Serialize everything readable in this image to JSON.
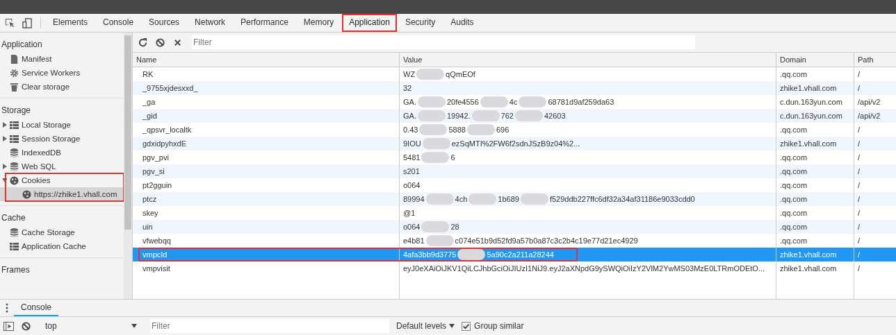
{
  "tabs": [
    {
      "label": "Elements",
      "selected": false,
      "highlighted": false
    },
    {
      "label": "Console",
      "selected": false,
      "highlighted": false
    },
    {
      "label": "Sources",
      "selected": false,
      "highlighted": false
    },
    {
      "label": "Network",
      "selected": false,
      "highlighted": false
    },
    {
      "label": "Performance",
      "selected": false,
      "highlighted": false
    },
    {
      "label": "Memory",
      "selected": false,
      "highlighted": false
    },
    {
      "label": "Application",
      "selected": true,
      "highlighted": true
    },
    {
      "label": "Security",
      "selected": false,
      "highlighted": false
    },
    {
      "label": "Audits",
      "selected": false,
      "highlighted": false
    }
  ],
  "sidebar": {
    "sections": [
      {
        "title": "Application",
        "items": [
          {
            "label": "Manifest",
            "kind": "file",
            "expandable": false,
            "selected": false,
            "highlighted": false
          },
          {
            "label": "Service Workers",
            "kind": "gear",
            "expandable": false,
            "selected": false,
            "highlighted": false
          },
          {
            "label": "Clear storage",
            "kind": "trash",
            "expandable": false,
            "selected": false,
            "highlighted": false
          }
        ]
      },
      {
        "title": "Storage",
        "items": [
          {
            "label": "Local Storage",
            "kind": "grid",
            "expandable": true,
            "selected": false,
            "highlighted": false
          },
          {
            "label": "Session Storage",
            "kind": "grid",
            "expandable": true,
            "selected": false,
            "highlighted": false
          },
          {
            "label": "IndexedDB",
            "kind": "db",
            "expandable": false,
            "selected": false,
            "highlighted": false
          },
          {
            "label": "Web SQL",
            "kind": "db",
            "expandable": true,
            "selected": false,
            "highlighted": false
          },
          {
            "label": "Cookies",
            "kind": "cookie",
            "expandable": true,
            "selected": false,
            "highlighted": true,
            "children": [
              {
                "label": "https://zhike1.vhall.com",
                "kind": "cookie",
                "expandable": false,
                "selected": true
              }
            ]
          }
        ]
      },
      {
        "title": "Cache",
        "items": [
          {
            "label": "Cache Storage",
            "kind": "db",
            "expandable": false,
            "selected": false,
            "highlighted": false
          },
          {
            "label": "Application Cache",
            "kind": "grid",
            "expandable": false,
            "selected": false,
            "highlighted": false
          }
        ]
      },
      {
        "title": "Frames"
      }
    ]
  },
  "filter": {
    "placeholder": "Filter"
  },
  "table": {
    "columns": [
      "Name",
      "Value",
      "Domain",
      "Path"
    ],
    "rows": [
      {
        "name": "RK",
        "value_parts": [
          "WZ",
          "qQmEOf"
        ],
        "domain": ".qq.com",
        "path": "/",
        "selected": false,
        "highlighted": false
      },
      {
        "name": "_9755xjdesxxd_",
        "value_parts": [
          "32"
        ],
        "domain": "zhike1.vhall.com",
        "path": "/",
        "selected": false,
        "highlighted": false
      },
      {
        "name": "_ga",
        "value_parts": [
          "GA.",
          "20fe4556",
          "4c",
          "68781d9af259da63"
        ],
        "domain": "c.dun.163yun.com",
        "path": "/api/v2",
        "selected": false,
        "highlighted": false
      },
      {
        "name": "_gid",
        "value_parts": [
          "GA.",
          "19942.",
          "762",
          "42603"
        ],
        "domain": "c.dun.163yun.com",
        "path": "/api/v2",
        "selected": false,
        "highlighted": false
      },
      {
        "name": "_qpsvr_localtk",
        "value_parts": [
          "0.43",
          "5888",
          "696"
        ],
        "domain": ".qq.com",
        "path": "/",
        "selected": false,
        "highlighted": false
      },
      {
        "name": "gdxidpyhxdE",
        "value_parts": [
          "9IOU",
          "ezSqMTI%2FW6f2sdnJSzB9z04%2..."
        ],
        "domain": "zhike1.vhall.com",
        "path": "/",
        "selected": false,
        "highlighted": false
      },
      {
        "name": "pgv_pvi",
        "value_parts": [
          "5481",
          "6"
        ],
        "domain": ".qq.com",
        "path": "/",
        "selected": false,
        "highlighted": false
      },
      {
        "name": "pgv_si",
        "value_parts": [
          "s201"
        ],
        "domain": ".qq.com",
        "path": "/",
        "selected": false,
        "highlighted": false
      },
      {
        "name": "pt2gguin",
        "value_parts": [
          "o064"
        ],
        "domain": ".qq.com",
        "path": "/",
        "selected": false,
        "highlighted": false
      },
      {
        "name": "ptcz",
        "value_parts": [
          "89994",
          "4ch",
          "1b689",
          "f529ddb227ffc6df32a34af31186e9033cdd0"
        ],
        "domain": ".qq.com",
        "path": "/",
        "selected": false,
        "highlighted": false
      },
      {
        "name": "skey",
        "value_parts": [
          "@1"
        ],
        "domain": ".qq.com",
        "path": "/",
        "selected": false,
        "highlighted": false
      },
      {
        "name": "uin",
        "value_parts": [
          "o064",
          "28"
        ],
        "domain": ".qq.com",
        "path": "/",
        "selected": false,
        "highlighted": false
      },
      {
        "name": "vfwebqq",
        "value_parts": [
          "e4b81",
          "c074e51b9d52fd9a57b0a87c3c2b4c19e77d21ec4929"
        ],
        "domain": ".qq.com",
        "path": "/",
        "selected": false,
        "highlighted": false
      },
      {
        "name": "vmpcId",
        "value_parts": [
          "4afa3bb9d3775",
          "5a90c2a211a28244"
        ],
        "domain": "zhike1.vhall.com",
        "path": "/",
        "selected": true,
        "highlighted": true
      },
      {
        "name": "vmpvisit",
        "value_parts": [
          "eyJ0eXAiOiJKV1QiLCJhbGciOiJIUzI1NiJ9.eyJ2aXNpdG9ySWQiOiIzY2VlM2YwMS03MzE0LTRmODEtO..."
        ],
        "domain": "zhike1.vhall.com",
        "path": "/",
        "selected": false,
        "highlighted": false
      }
    ]
  },
  "drawer": {
    "tab": "Console",
    "context": "top",
    "filter_placeholder": "Filter",
    "levels": "Default levels",
    "group_similar": {
      "label": "Group similar",
      "checked": true
    }
  }
}
